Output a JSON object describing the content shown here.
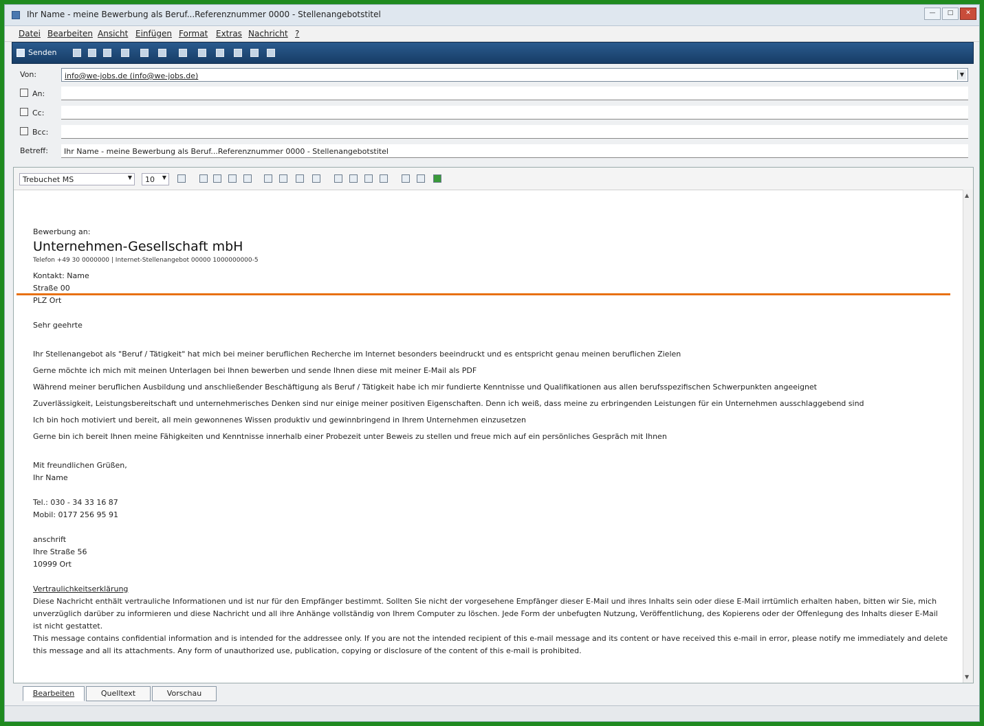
{
  "window": {
    "title": "Ihr Name - meine Bewerbung als Beruf...Referenznummer 0000 - Stellenangebotstitel"
  },
  "menu": [
    "Datei",
    "Bearbeiten",
    "Ansicht",
    "Einfügen",
    "Format",
    "Extras",
    "Nachricht",
    "?"
  ],
  "toolbar": {
    "send_label": "Senden"
  },
  "header": {
    "from_label": "Von:",
    "from_value": "info@we-jobs.de   (info@we-jobs.de)",
    "to_label": "An:",
    "cc_label": "Cc:",
    "bcc_label": "Bcc:",
    "subject_label": "Betreff:",
    "subject_value": "Ihr Name - meine Bewerbung als Beruf...Referenznummer 0000 - Stellenangebotstitel"
  },
  "format": {
    "font": "Trebuchet MS",
    "size": "10"
  },
  "letter": {
    "intro": "Bewerbung an:",
    "company": "Unternehmen-Gesellschaft mbH",
    "company_line": "Telefon +49 30 0000000 | Internet-Stellenangebot 00000 1000000000-5",
    "contact": "Kontakt: Name",
    "street": "Straße 00",
    "city": "PLZ Ort",
    "salutation": "Sehr geehrte",
    "p1": "Ihr Stellenangebot als \"Beruf / Tätigkeit\" hat mich bei meiner beruflichen Recherche im Internet besonders beeindruckt und es entspricht genau meinen beruflichen Zielen",
    "p2": "Gerne möchte ich mich mit meinen Unterlagen bei Ihnen bewerben und sende Ihnen diese mit meiner E-Mail als PDF",
    "p3": "Während meiner beruflichen Ausbildung und anschließender Beschäftigung als Beruf / Tätigkeit habe ich mir fundierte Kenntnisse und Qualifikationen aus allen berufsspezifischen Schwerpunkten angeeignet",
    "p4": "Zuverlässigkeit, Leistungsbereitschaft und unternehmerisches Denken sind nur einige meiner positiven Eigenschaften. Denn ich weiß, dass meine zu erbringenden Leistungen für ein Unternehmen ausschlaggebend sind",
    "p5": "Ich bin hoch motiviert und bereit, all mein gewonnenes Wissen produktiv und gewinnbringend in Ihrem Unternehmen einzusetzen",
    "p6": "Gerne bin ich bereit Ihnen meine Fähigkeiten und Kenntnisse innerhalb einer Probezeit unter Beweis zu stellen und freue mich auf ein persönliches Gespräch mit Ihnen",
    "closing": "Mit freundlichen Grüßen,",
    "name": "Ihr Name",
    "phone": "Tel.: 030 - 34 33 16 87",
    "mobile": "Mobil: 0177 256 95 91",
    "address_label": "anschrift",
    "address_street": "Ihre Straße 56",
    "address_city": "10999 Ort",
    "disclaimer_title": "Vertraulichkeitserklärung",
    "disclaimer_de": "Diese Nachricht enthält vertrauliche Informationen und ist nur für den Empfänger bestimmt. Sollten Sie nicht der vorgesehene Empfänger dieser E-Mail und ihres Inhalts sein oder diese E-Mail irrtümlich erhalten haben, bitten wir Sie, mich unverzüglich darüber zu informieren und diese Nachricht und all ihre Anhänge vollständig von Ihrem Computer zu löschen. Jede Form der unbefugten Nutzung, Veröffentlichung, des Kopierens oder der Offenlegung des Inhalts dieser E-Mail ist nicht gestattet.",
    "disclaimer_en": "This message contains confidential information and is intended for the addressee only. If you are not the intended recipient of this e-mail message and its content or have received this e-mail in error, please notify me immediately and delete this message and all its attachments. Any form of unauthorized use, publication, copying or disclosure of the content of this e-mail is prohibited."
  },
  "tabs": [
    "Bearbeiten",
    "Quelltext",
    "Vorschau"
  ]
}
